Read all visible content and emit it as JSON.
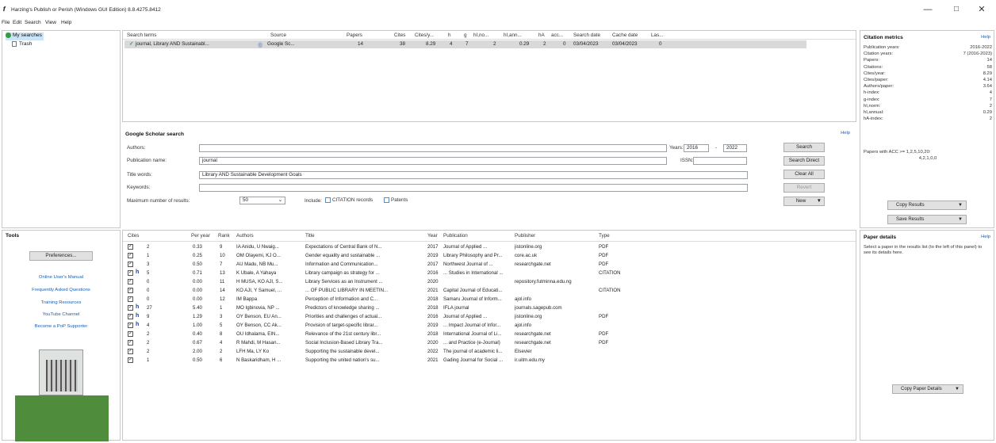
{
  "window": {
    "title": "Harzing's Publish or Perish (Windows GUI Edition) 8.8.4275.8412",
    "minimize": "—",
    "maximize": "□",
    "close": "✕"
  },
  "menu": [
    "File",
    "Edit",
    "Search",
    "View",
    "Help"
  ],
  "tree": {
    "my_searches": "My searches",
    "trash": "Trash"
  },
  "results": {
    "headers": [
      "Search terms",
      "Source",
      "Papers",
      "Cites",
      "Cites/y...",
      "h",
      "g",
      "hI,no...",
      "hI,ann...",
      "hA",
      "acc...",
      "Search date",
      "Cache date",
      "Las..."
    ],
    "row": [
      "journal, Library AND Sustainabl...",
      "Google Sc...",
      "14",
      "38",
      "8.29",
      "4",
      "7",
      "2",
      "0.29",
      "2",
      "0",
      "03/04/2023",
      "03/04/2023",
      "0"
    ]
  },
  "scholar": {
    "title": "Google Scholar search",
    "help": "Help",
    "labels": {
      "authors": "Authors:",
      "pubname": "Publication name:",
      "title": "Title words:",
      "keywords": "Keywords:",
      "max": "Maximum number of results:",
      "years": "Years:",
      "dash": "-",
      "issn": "ISSN:",
      "include": "Include:"
    },
    "values": {
      "authors": "",
      "pubname": "journal",
      "title": "Library AND Sustainable Development Goals",
      "keywords": "",
      "max": "50",
      "year_from": "2016",
      "year_to": "2022",
      "issn": ""
    },
    "checks": {
      "citation": "CITATION records",
      "patents": "Patents"
    },
    "buttons": {
      "search": "Search",
      "search_direct": "Search Direct",
      "clear_all": "Clear All",
      "revert": "Revert",
      "new": "New"
    }
  },
  "tools": {
    "title": "Tools",
    "preferences": "Preferences...",
    "links": [
      "Online User's Manual",
      "Frequently Asked Questions",
      "Training Resources",
      "YouTube Channel",
      "Become a PoP Supporter"
    ]
  },
  "papers": {
    "headers": [
      "Cites",
      "Per year",
      "Rank",
      "Authors",
      "Title",
      "Year",
      "Publication",
      "Publisher",
      "Type"
    ],
    "rows": [
      {
        "h": "",
        "cites": "2",
        "peryear": "0.33",
        "rank": "9",
        "authors": "IA Anidu, U Nwaig...",
        "title": "Expectations of Central Bank of N...",
        "year": "2017",
        "pub": "Journal of Applied ...",
        "publisher": "jistonline.org",
        "type": "PDF"
      },
      {
        "h": "",
        "cites": "1",
        "peryear": "0.25",
        "rank": "10",
        "authors": "OM Olayemi, KJ O...",
        "title": "Gender equality and sustainable ...",
        "year": "2019",
        "pub": "Library Philosophy and Pr...",
        "publisher": "core.ac.uk",
        "type": "PDF"
      },
      {
        "h": "",
        "cites": "3",
        "peryear": "0.50",
        "rank": "7",
        "authors": "AU Madu, NB Mu...",
        "title": "Information and Communication...",
        "year": "2017",
        "pub": "Northwest Journal of ...",
        "publisher": "researchgate.net",
        "type": "PDF"
      },
      {
        "h": "h",
        "cites": "5",
        "peryear": "0.71",
        "rank": "13",
        "authors": "K Ubale, A Yahaya",
        "title": "Library campaign as strategy for ...",
        "year": "2016",
        "pub": "... Studies in International ...",
        "publisher": "",
        "type": "CITATION"
      },
      {
        "h": "",
        "cites": "0",
        "peryear": "0.00",
        "rank": "11",
        "authors": "H MUSA, KO AJI, S...",
        "title": "Library Services as an Instrument ...",
        "year": "2020",
        "pub": "",
        "publisher": "repository.futminna.edu.ng",
        "type": ""
      },
      {
        "h": "",
        "cites": "0",
        "peryear": "0.00",
        "rank": "14",
        "authors": "KO AJI, Y Samuel, ...",
        "title": "... OF PUBLIC LIBRARY IN MEETIN...",
        "year": "2021",
        "pub": "Capital Journal of Educati...",
        "publisher": "",
        "type": "CITATION"
      },
      {
        "h": "",
        "cites": "0",
        "peryear": "0.00",
        "rank": "12",
        "authors": "IM Bappa",
        "title": "Perception of Information and C...",
        "year": "2018",
        "pub": "Samaru Journal of Inform...",
        "publisher": "ajol.info",
        "type": ""
      },
      {
        "h": "h",
        "cites": "27",
        "peryear": "5.40",
        "rank": "1",
        "authors": "MO Igbinovia, NP ...",
        "title": "Predictors of knowledge sharing ...",
        "year": "2018",
        "pub": "IFLA journal",
        "publisher": "journals.sagepub.com",
        "type": ""
      },
      {
        "h": "h",
        "cites": "9",
        "peryear": "1.29",
        "rank": "3",
        "authors": "OY Benson, EU An...",
        "title": "Priorities and challenges of actual...",
        "year": "2016",
        "pub": "Journal of Applied ...",
        "publisher": "jistonline.org",
        "type": "PDF"
      },
      {
        "h": "h",
        "cites": "4",
        "peryear": "1.00",
        "rank": "5",
        "authors": "OY Benson, CC Ak...",
        "title": "Provision of target-specific librar...",
        "year": "2019",
        "pub": "... Impact Journal of Infor...",
        "publisher": "ajol.info",
        "type": ""
      },
      {
        "h": "",
        "cites": "2",
        "peryear": "0.40",
        "rank": "8",
        "authors": "OU Idhalama, EIN...",
        "title": "Relevance of the 21st century libr...",
        "year": "2018",
        "pub": "International Journal of Li...",
        "publisher": "researchgate.net",
        "type": "PDF"
      },
      {
        "h": "",
        "cites": "2",
        "peryear": "0.67",
        "rank": "4",
        "authors": "R Mahdi, M Hasan...",
        "title": "Social Inclusion-Based Library Tra...",
        "year": "2020",
        "pub": "... and Practice (e-Journal)",
        "publisher": "researchgate.net",
        "type": "PDF"
      },
      {
        "h": "",
        "cites": "2",
        "peryear": "2.00",
        "rank": "2",
        "authors": "LFH Ma, LY Ko",
        "title": "Supporting the sustainable devel...",
        "year": "2022",
        "pub": "The journal of academic li...",
        "publisher": "Elsevier",
        "type": ""
      },
      {
        "h": "",
        "cites": "1",
        "peryear": "0.50",
        "rank": "6",
        "authors": "N Baskaridham, H ...",
        "title": "Supporting the united nation's su...",
        "year": "2021",
        "pub": "Gading Journal for Social ...",
        "publisher": "ir.uitm.edu.my",
        "type": ""
      }
    ]
  },
  "metrics": {
    "title": "Citation metrics",
    "help": "Help",
    "rows": [
      {
        "label": "Publication years:",
        "value": "2016-2022"
      },
      {
        "label": "Citation years:",
        "value": "7 (2016-2023)"
      },
      {
        "label": "Papers:",
        "value": "14"
      },
      {
        "label": "Citations:",
        "value": "58"
      },
      {
        "label": "Cites/year:",
        "value": "8.29"
      },
      {
        "label": "Cites/paper:",
        "value": "4.14"
      },
      {
        "label": "Authors/paper:",
        "value": "3.64"
      },
      {
        "label": "h-index:",
        "value": "4"
      },
      {
        "label": "g-index:",
        "value": "7"
      },
      {
        "label": "hI,norm:",
        "value": "2"
      },
      {
        "label": "hI,annual:",
        "value": "0.29"
      },
      {
        "label": "hA-index:",
        "value": "2"
      }
    ],
    "acc_label": "Papers with ACC >= 1,2,5,10,20:",
    "acc_value": "4,2,1,0,0",
    "copy_results": "Copy Results",
    "save_results": "Save Results"
  },
  "details": {
    "title": "Paper details",
    "help": "Help",
    "text": "Select a paper in the results list (to the left of this panel) to see its details here.",
    "copy_details": "Copy Paper Details"
  }
}
